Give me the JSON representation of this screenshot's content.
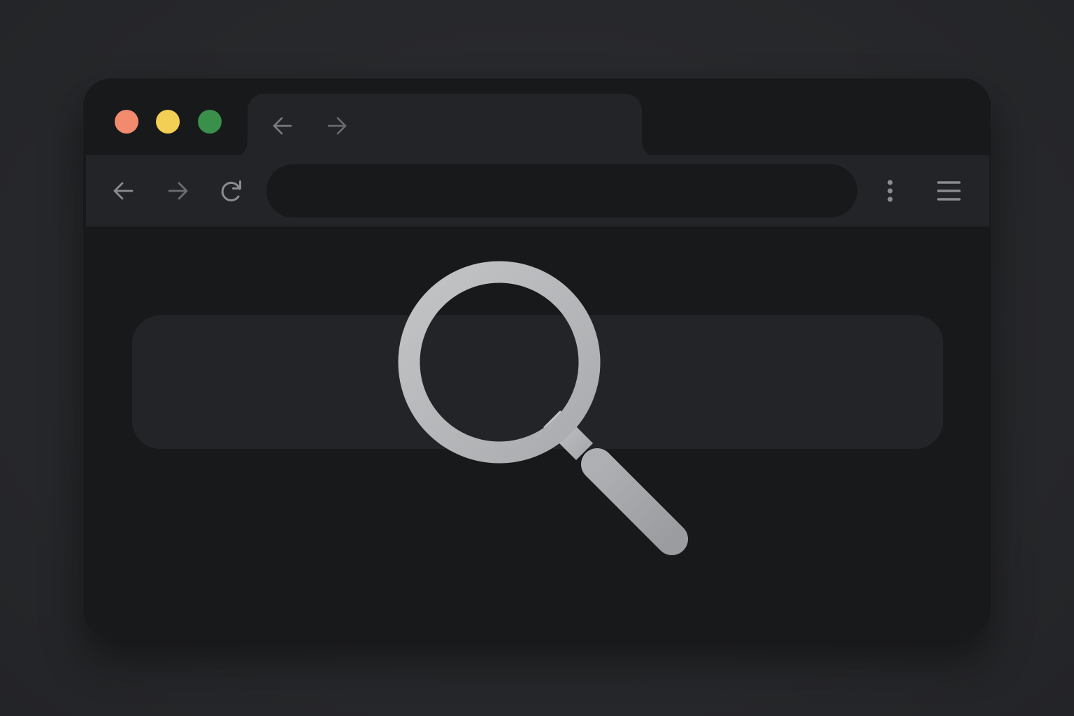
{
  "window": {
    "traffic_lights": [
      {
        "name": "close",
        "color": "#f28b6e"
      },
      {
        "name": "minimize",
        "color": "#f3cf55"
      },
      {
        "name": "zoom",
        "color": "#3a8f4a"
      }
    ]
  },
  "tab": {
    "icons": [
      "back-arrow-icon",
      "forward-arrow-icon"
    ]
  },
  "toolbar": {
    "icons": [
      "back-arrow-icon",
      "forward-arrow-icon",
      "reload-icon",
      "more-vertical-icon",
      "hamburger-menu-icon"
    ],
    "address_value": "",
    "address_placeholder": ""
  },
  "content": {
    "search_box_value": "",
    "hero_icon": "magnifying-glass-icon"
  },
  "colors": {
    "background": "#28292c",
    "window": "#18191b",
    "toolbar": "#232427",
    "icon": "#8a8c90",
    "icon_dim": "#6a6c70",
    "magnifier": "#b4b6b9"
  }
}
